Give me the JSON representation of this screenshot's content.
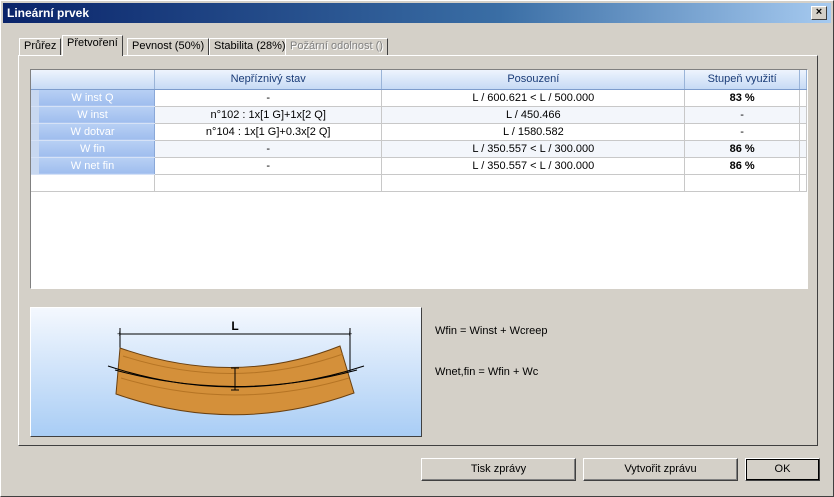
{
  "window": {
    "title": "Lineární prvek",
    "close_label": "×"
  },
  "tabs": [
    {
      "label": "Průřez",
      "state": "normal"
    },
    {
      "label": "Přetvoření",
      "state": "active"
    },
    {
      "label": "Pevnost (50%)",
      "state": "normal"
    },
    {
      "label": "Stabilita (28%)",
      "state": "normal"
    },
    {
      "label": "Požární odolnost ()",
      "state": "disabled"
    }
  ],
  "table": {
    "columns": [
      "",
      "Nepříznivý stav",
      "Posouzení",
      "Stupeň využití"
    ],
    "rows": [
      {
        "name": "W inst Q",
        "state": "-",
        "check": "L / 600.621 < L / 500.000",
        "usage": "83 %",
        "bold": true
      },
      {
        "name": "W inst",
        "state": "n°102 : 1x[1 G]+1x[2 Q]",
        "check": "L / 450.466",
        "usage": "-",
        "bold": false
      },
      {
        "name": "W dotvar",
        "state": "n°104 : 1x[1 G]+0.3x[2 Q]",
        "check": "L / 1580.582",
        "usage": "-",
        "bold": false
      },
      {
        "name": "W fin",
        "state": "-",
        "check": "L / 350.557 < L / 300.000",
        "usage": "86 %",
        "bold": true
      },
      {
        "name": "W net fin",
        "state": "-",
        "check": "L / 350.557 < L / 300.000",
        "usage": "86 %",
        "bold": true
      }
    ]
  },
  "diagram": {
    "span_label": "L"
  },
  "formulas": {
    "wfin": "Wfin = Winst + Wcreep",
    "wnetfin": "Wnet,fin = Wfin + Wc"
  },
  "buttons": {
    "print": "Tisk zprávy",
    "create": "Vytvořit zprávu",
    "ok": "OK"
  },
  "colors": {
    "title_bar": "#0a246a",
    "beam_fill": "#d4903a",
    "header_text": "#1a3c78"
  }
}
